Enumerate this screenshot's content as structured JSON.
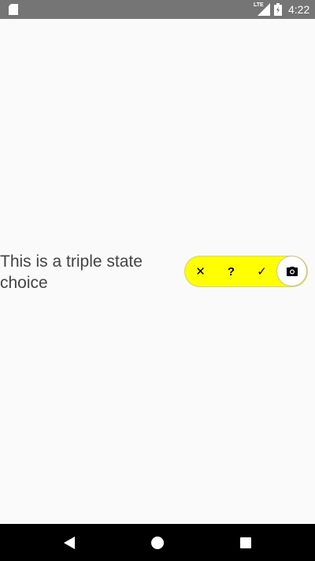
{
  "status_bar": {
    "time": "4:22",
    "network": "LTE",
    "icons": [
      "sd-card-icon",
      "signal-icon",
      "battery-icon"
    ]
  },
  "main": {
    "label": "This is a triple state choice",
    "tri_state": {
      "options": [
        {
          "icon": "close-icon",
          "glyph": "✕"
        },
        {
          "icon": "question-icon",
          "glyph": "?"
        },
        {
          "icon": "check-icon",
          "glyph": "✓"
        }
      ],
      "thumb_icon": "camera-icon",
      "track_color": "#ffff00",
      "thumb_color": "#ffffff"
    }
  },
  "nav_bar": {
    "icons": [
      "back-icon",
      "home-icon",
      "recents-icon"
    ]
  }
}
